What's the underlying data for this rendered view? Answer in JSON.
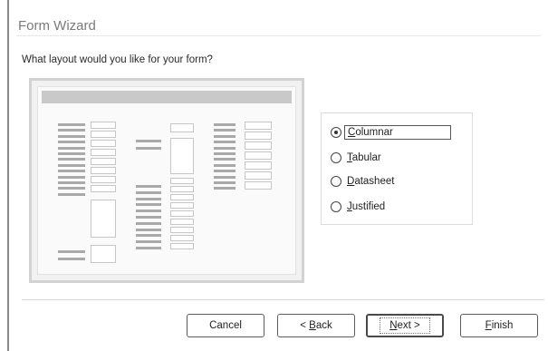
{
  "window": {
    "title": "Form Wizard"
  },
  "prompt": "What layout would you like for your form?",
  "layout_options": [
    {
      "mnemonic": "C",
      "rest": "olumnar",
      "selected": true
    },
    {
      "mnemonic": "T",
      "rest": "abular",
      "selected": false
    },
    {
      "mnemonic": "D",
      "rest": "atasheet",
      "selected": false
    },
    {
      "mnemonic": "J",
      "rest": "ustified",
      "selected": false
    }
  ],
  "buttons": {
    "cancel": "Cancel",
    "back_pre": "< ",
    "back_key": "B",
    "back_rest": "ack",
    "next_key": "N",
    "next_rest": "ext >",
    "finish_key": "F",
    "finish_rest": "inish"
  },
  "colors": {
    "preview_header": "#c9c9c9",
    "preview_bar": "#a9a9a9",
    "title_text": "#7a7a7a"
  }
}
